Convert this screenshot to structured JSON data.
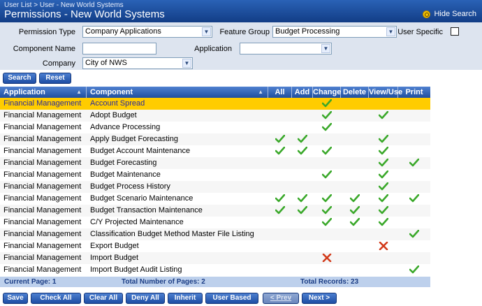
{
  "header": {
    "breadcrumb": "User List > User - New World Systems",
    "title": "Permissions - New World Systems",
    "hide_search": "Hide Search"
  },
  "search": {
    "permission_type_label": "Permission Type",
    "permission_type_value": "Company Applications",
    "feature_group_label": "Feature Group",
    "feature_group_value": "Budget Processing",
    "user_specific_label": "User Specific",
    "user_specific_checked": false,
    "component_name_label": "Component Name",
    "component_name_value": "",
    "application_label": "Application",
    "application_value": "",
    "company_label": "Company",
    "company_value": "City of NWS",
    "search_button": "Search",
    "reset_button": "Reset"
  },
  "grid": {
    "columns": [
      "Application",
      "Component",
      "All",
      "Add",
      "Change",
      "Delete",
      "View/Use",
      "Print"
    ],
    "rows": [
      {
        "application": "Financial Management",
        "component": "Account Spread",
        "marks": [
          "",
          "",
          "check",
          "",
          "",
          ""
        ],
        "selected": true
      },
      {
        "application": "Financial Management",
        "component": "Adopt Budget",
        "marks": [
          "",
          "",
          "check",
          "",
          "check",
          ""
        ]
      },
      {
        "application": "Financial Management",
        "component": "Advance Processing",
        "marks": [
          "",
          "",
          "check",
          "",
          "",
          ""
        ]
      },
      {
        "application": "Financial Management",
        "component": "Apply Budget Forecasting",
        "marks": [
          "check",
          "check",
          "",
          "",
          "check",
          ""
        ]
      },
      {
        "application": "Financial Management",
        "component": "Budget Account Maintenance",
        "marks": [
          "check",
          "check",
          "check",
          "",
          "check",
          ""
        ]
      },
      {
        "application": "Financial Management",
        "component": "Budget Forecasting",
        "marks": [
          "",
          "",
          "",
          "",
          "check",
          "check"
        ]
      },
      {
        "application": "Financial Management",
        "component": "Budget Maintenance",
        "marks": [
          "",
          "",
          "check",
          "",
          "check",
          ""
        ]
      },
      {
        "application": "Financial Management",
        "component": "Budget Process History",
        "marks": [
          "",
          "",
          "",
          "",
          "check",
          ""
        ]
      },
      {
        "application": "Financial Management",
        "component": "Budget Scenario Maintenance",
        "marks": [
          "check",
          "check",
          "check",
          "check",
          "check",
          "check"
        ]
      },
      {
        "application": "Financial Management",
        "component": "Budget Transaction Maintenance",
        "marks": [
          "check",
          "check",
          "check",
          "check",
          "check",
          ""
        ]
      },
      {
        "application": "Financial Management",
        "component": "C/Y Projected Maintenance",
        "marks": [
          "",
          "",
          "check",
          "check",
          "check",
          ""
        ]
      },
      {
        "application": "Financial Management",
        "component": "Classification Budget Method Master File Listing",
        "marks": [
          "",
          "",
          "",
          "",
          "",
          "check"
        ]
      },
      {
        "application": "Financial Management",
        "component": "Export Budget",
        "marks": [
          "",
          "",
          "",
          "",
          "deny",
          ""
        ]
      },
      {
        "application": "Financial Management",
        "component": "Import Budget",
        "marks": [
          "",
          "",
          "deny",
          "",
          "",
          ""
        ]
      },
      {
        "application": "Financial Management",
        "component": "Import Budget Audit Listing",
        "marks": [
          "",
          "",
          "",
          "",
          "",
          "check"
        ]
      }
    ],
    "footer": {
      "current_page": "Current Page: 1",
      "total_pages": "Total Number of Pages: 2",
      "total_records": "Total Records: 23"
    }
  },
  "actions": {
    "save": "Save",
    "check_all": "Check All",
    "clear_all": "Clear All",
    "deny_all": "Deny All",
    "inherit": "Inherit",
    "user_based": "User Based",
    "prev": "< Prev",
    "next": "Next >"
  },
  "colors": {
    "header": "#1f4f9f",
    "selected_row": "#ffcc00",
    "check": "#3aa82a",
    "deny": "#d23a1a"
  }
}
